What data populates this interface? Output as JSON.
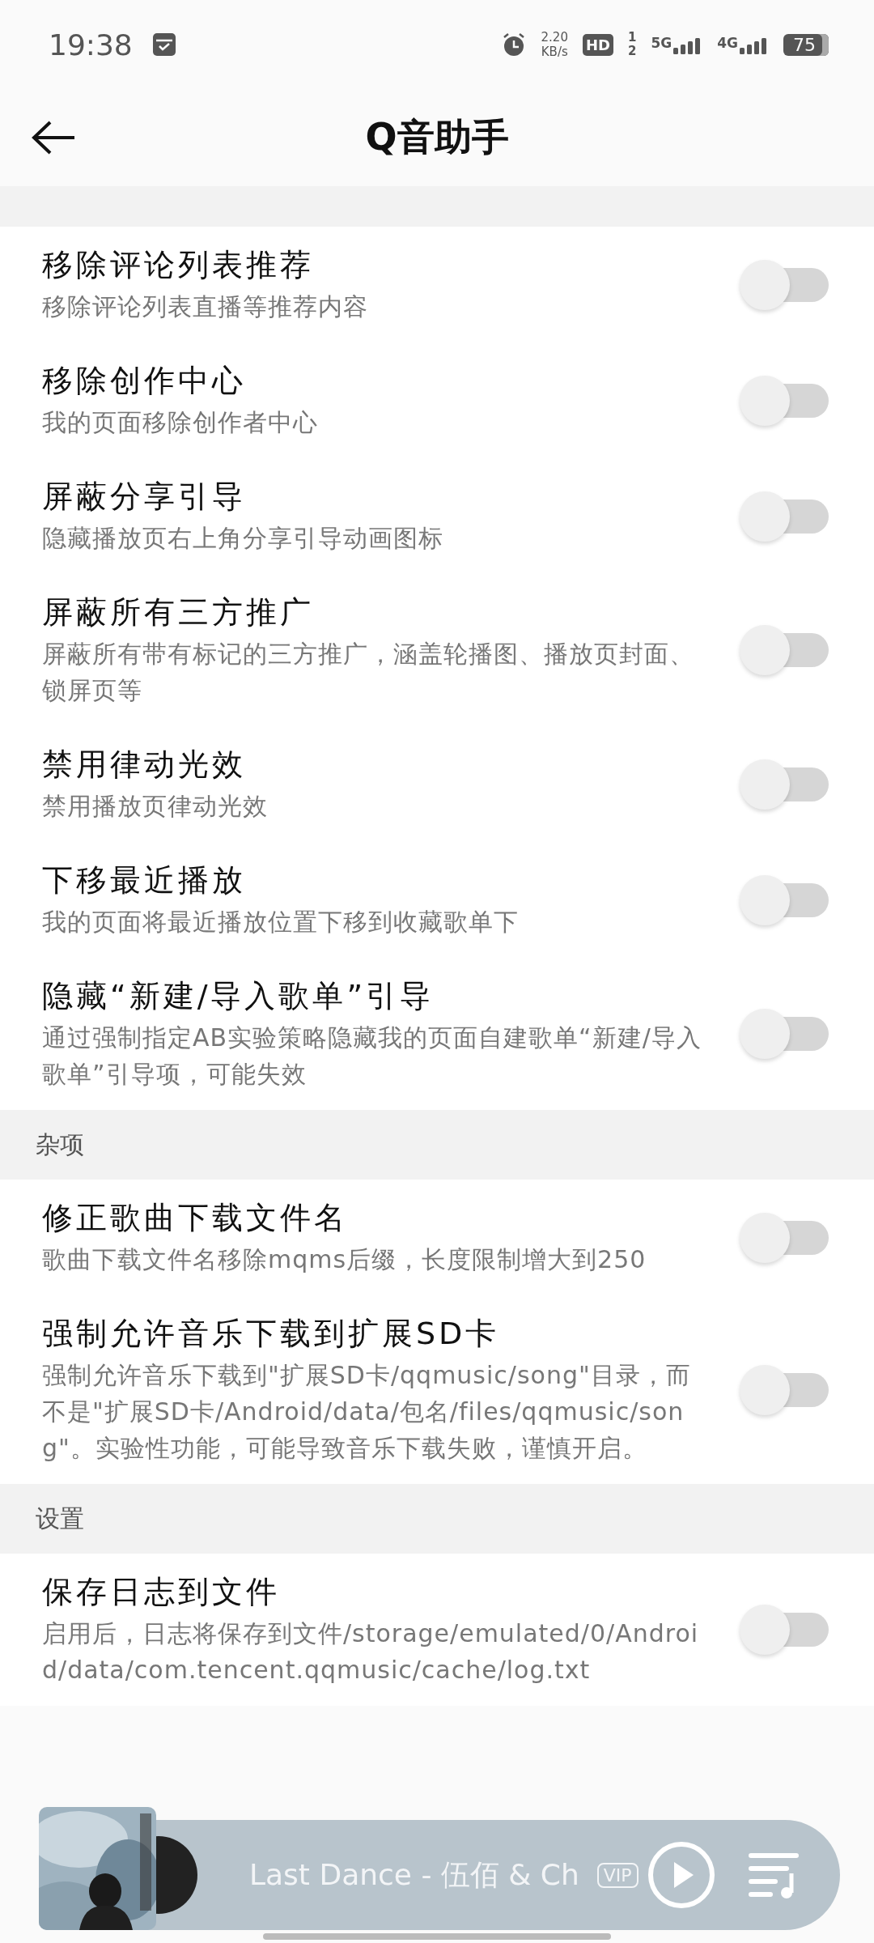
{
  "status_bar": {
    "time": "19:38",
    "net_speed": "2.20",
    "net_unit": "KB/s",
    "hd": "HD",
    "sim_1": "1",
    "sim_2": "2",
    "net_1": "5G",
    "net_2": "4G",
    "battery": "75"
  },
  "header": {
    "title": "Q音助手"
  },
  "sections": [
    {
      "items": [
        {
          "title": "移除评论列表推荐",
          "description": "移除评论列表直播等推荐内容",
          "on": false
        },
        {
          "title": "移除创作中心",
          "description": "我的页面移除创作者中心",
          "on": false
        },
        {
          "title": "屏蔽分享引导",
          "description": "隐藏播放页右上角分享引导动画图标",
          "on": false
        },
        {
          "title": "屏蔽所有三方推广",
          "description": "屏蔽所有带有标记的三方推广，涵盖轮播图、播放页封面、锁屏页等",
          "on": false
        },
        {
          "title": "禁用律动光效",
          "description": "禁用播放页律动光效",
          "on": false
        },
        {
          "title": "下移最近播放",
          "description": "我的页面将最近播放位置下移到收藏歌单下",
          "on": false
        },
        {
          "title": "隐藏“新建/导入歌单”引导",
          "description": "通过强制指定AB实验策略隐藏我的页面自建歌单“新建/导入歌单”引导项，可能失效",
          "on": false
        }
      ]
    },
    {
      "title": "杂项",
      "items": [
        {
          "title": "修正歌曲下载文件名",
          "description": "歌曲下载文件名移除mqms后缀，长度限制增大到250",
          "on": false
        },
        {
          "title": "强制允许音乐下载到扩展SD卡",
          "description": "强制允许音乐下载到\"扩展SD卡/qqmusic/song\"目录，而不是\"扩展SD卡/Android/data/包名/files/qqmusic/song\"。实验性功能，可能导致音乐下载失败，谨慎开启。",
          "on": false
        }
      ]
    },
    {
      "title": "设置",
      "items": [
        {
          "title": "保存日志到文件",
          "description": "启用后，日志将保存到文件/storage/emulated/0/Android/data/com.tencent.qqmusic/cache/log.txt",
          "on": false
        }
      ]
    }
  ],
  "mini_player": {
    "song": "Last Dance - 伍佰 & Ch",
    "badge": "VIP"
  }
}
